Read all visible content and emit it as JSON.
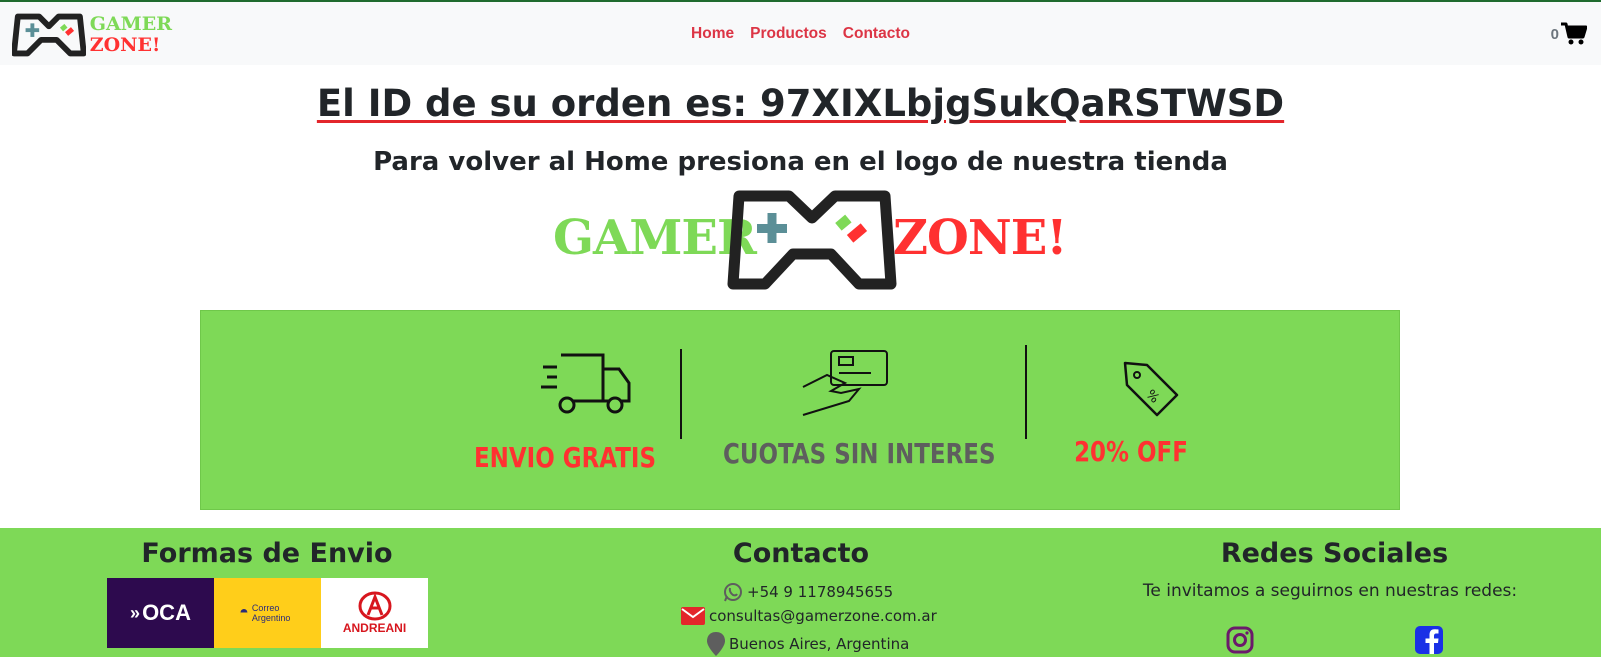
{
  "brand": {
    "line1": "GAMER",
    "line2": "ZONE!",
    "color_green": "#7ed957",
    "color_red": "#ff3131"
  },
  "nav": {
    "links": [
      "Home",
      "Productos",
      "Contacto"
    ],
    "cart_count": "0",
    "cart_icon": "shopping-cart-icon"
  },
  "main": {
    "order_title": "El ID de su orden es: 97XIXLbjgSukQaRSTWSD",
    "subtitle": "Para volver al Home presiona en el logo de nuestra tienda"
  },
  "promo": {
    "background": "#7ed957",
    "items": [
      {
        "icon": "delivery-truck-icon",
        "label": "ENVIO GRATIS"
      },
      {
        "icon": "credit-card-payment-icon",
        "label": "CUOTAS SIN INTERES"
      },
      {
        "icon": "discount-tag-icon",
        "label": "20% OFF"
      }
    ]
  },
  "footer": {
    "shipping": {
      "heading": "Formas de Envio",
      "carriers": [
        "OCA",
        "Correo Argentino",
        "ANDREANI"
      ]
    },
    "contact": {
      "heading": "Contacto",
      "phone": "+54 9 1178945655",
      "email": "consultas@gamerzone.com.ar",
      "location": "Buenos Aires, Argentina"
    },
    "social": {
      "heading": "Redes Sociales",
      "text": "Te invitamos a seguirnos en nuestras redes:",
      "networks": [
        "instagram-icon",
        "facebook-icon"
      ]
    }
  }
}
